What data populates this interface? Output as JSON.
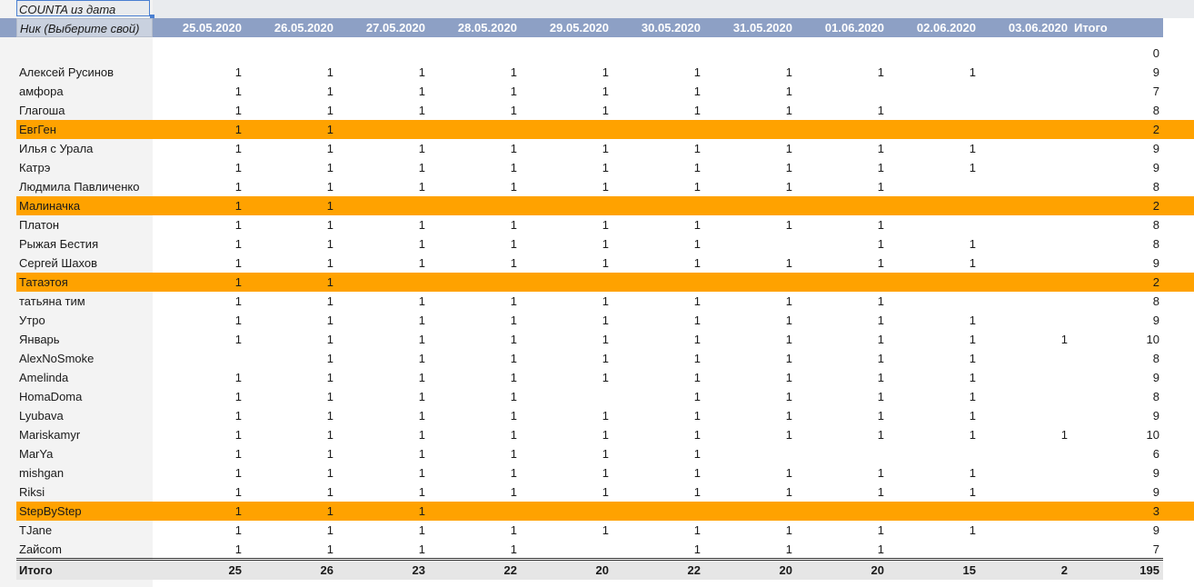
{
  "pivot": {
    "title": "COUNTA из дата",
    "row_header": "Ник (Выберите свой)",
    "dates": [
      "25.05.2020",
      "26.05.2020",
      "27.05.2020",
      "28.05.2020",
      "29.05.2020",
      "30.05.2020",
      "31.05.2020",
      "01.06.2020",
      "02.06.2020",
      "03.06.2020"
    ],
    "total_label": "Итого",
    "highlight_color": "#ffa200",
    "header_color": "#8da0c5",
    "rows": [
      {
        "name": "",
        "vals": [
          "",
          "",
          "",
          "",
          "",
          "",
          "",
          "",
          "",
          ""
        ],
        "total": "0",
        "highlight": false
      },
      {
        "name": "Алексей Русинов",
        "vals": [
          "1",
          "1",
          "1",
          "1",
          "1",
          "1",
          "1",
          "1",
          "1",
          ""
        ],
        "total": "9",
        "highlight": false
      },
      {
        "name": "амфора",
        "vals": [
          "1",
          "1",
          "1",
          "1",
          "1",
          "1",
          "1",
          "",
          "",
          ""
        ],
        "total": "7",
        "highlight": false
      },
      {
        "name": "Глагоша",
        "vals": [
          "1",
          "1",
          "1",
          "1",
          "1",
          "1",
          "1",
          "1",
          "",
          ""
        ],
        "total": "8",
        "highlight": false
      },
      {
        "name": "ЕвгГен",
        "vals": [
          "1",
          "1",
          "",
          "",
          "",
          "",
          "",
          "",
          "",
          ""
        ],
        "total": "2",
        "highlight": true
      },
      {
        "name": "Илья с Урала",
        "vals": [
          "1",
          "1",
          "1",
          "1",
          "1",
          "1",
          "1",
          "1",
          "1",
          ""
        ],
        "total": "9",
        "highlight": false
      },
      {
        "name": "Катрэ",
        "vals": [
          "1",
          "1",
          "1",
          "1",
          "1",
          "1",
          "1",
          "1",
          "1",
          ""
        ],
        "total": "9",
        "highlight": false
      },
      {
        "name": "Людмила Павличенко",
        "vals": [
          "1",
          "1",
          "1",
          "1",
          "1",
          "1",
          "1",
          "1",
          "",
          ""
        ],
        "total": "8",
        "highlight": false
      },
      {
        "name": "Малиначка",
        "vals": [
          "1",
          "1",
          "",
          "",
          "",
          "",
          "",
          "",
          "",
          ""
        ],
        "total": "2",
        "highlight": true
      },
      {
        "name": "Платон",
        "vals": [
          "1",
          "1",
          "1",
          "1",
          "1",
          "1",
          "1",
          "1",
          "",
          ""
        ],
        "total": "8",
        "highlight": false
      },
      {
        "name": "Рыжая Бестия",
        "vals": [
          "1",
          "1",
          "1",
          "1",
          "1",
          "1",
          "",
          "1",
          "1",
          ""
        ],
        "total": "8",
        "highlight": false
      },
      {
        "name": "Сергей Шахов",
        "vals": [
          "1",
          "1",
          "1",
          "1",
          "1",
          "1",
          "1",
          "1",
          "1",
          ""
        ],
        "total": "9",
        "highlight": false
      },
      {
        "name": "Татаэтоя",
        "vals": [
          "1",
          "1",
          "",
          "",
          "",
          "",
          "",
          "",
          "",
          ""
        ],
        "total": "2",
        "highlight": true
      },
      {
        "name": "татьяна тим",
        "vals": [
          "1",
          "1",
          "1",
          "1",
          "1",
          "1",
          "1",
          "1",
          "",
          ""
        ],
        "total": "8",
        "highlight": false
      },
      {
        "name": "Утро",
        "vals": [
          "1",
          "1",
          "1",
          "1",
          "1",
          "1",
          "1",
          "1",
          "1",
          ""
        ],
        "total": "9",
        "highlight": false
      },
      {
        "name": "Январь",
        "vals": [
          "1",
          "1",
          "1",
          "1",
          "1",
          "1",
          "1",
          "1",
          "1",
          "1"
        ],
        "total": "10",
        "highlight": false
      },
      {
        "name": "AlexNoSmoke",
        "vals": [
          "",
          "1",
          "1",
          "1",
          "1",
          "1",
          "1",
          "1",
          "1",
          ""
        ],
        "total": "8",
        "highlight": false
      },
      {
        "name": "Amelinda",
        "vals": [
          "1",
          "1",
          "1",
          "1",
          "1",
          "1",
          "1",
          "1",
          "1",
          ""
        ],
        "total": "9",
        "highlight": false
      },
      {
        "name": "HomaDoma",
        "vals": [
          "1",
          "1",
          "1",
          "1",
          "",
          "1",
          "1",
          "1",
          "1",
          ""
        ],
        "total": "8",
        "highlight": false
      },
      {
        "name": "Lyubava",
        "vals": [
          "1",
          "1",
          "1",
          "1",
          "1",
          "1",
          "1",
          "1",
          "1",
          ""
        ],
        "total": "9",
        "highlight": false
      },
      {
        "name": "Mariskamyr",
        "vals": [
          "1",
          "1",
          "1",
          "1",
          "1",
          "1",
          "1",
          "1",
          "1",
          "1"
        ],
        "total": "10",
        "highlight": false
      },
      {
        "name": "MarYa",
        "vals": [
          "1",
          "1",
          "1",
          "1",
          "1",
          "1",
          "",
          "",
          "",
          ""
        ],
        "total": "6",
        "highlight": false
      },
      {
        "name": "mishgan",
        "vals": [
          "1",
          "1",
          "1",
          "1",
          "1",
          "1",
          "1",
          "1",
          "1",
          ""
        ],
        "total": "9",
        "highlight": false
      },
      {
        "name": "Riksi",
        "vals": [
          "1",
          "1",
          "1",
          "1",
          "1",
          "1",
          "1",
          "1",
          "1",
          ""
        ],
        "total": "9",
        "highlight": false
      },
      {
        "name": "StepByStep",
        "vals": [
          "1",
          "1",
          "1",
          "",
          "",
          "",
          "",
          "",
          "",
          ""
        ],
        "total": "3",
        "highlight": true
      },
      {
        "name": "TJane",
        "vals": [
          "1",
          "1",
          "1",
          "1",
          "1",
          "1",
          "1",
          "1",
          "1",
          ""
        ],
        "total": "9",
        "highlight": false
      },
      {
        "name": "Zайсom",
        "vals": [
          "1",
          "1",
          "1",
          "1",
          "",
          "1",
          "1",
          "1",
          "",
          ""
        ],
        "total": "7",
        "highlight": false
      }
    ],
    "totals": {
      "label": "Итого",
      "vals": [
        "25",
        "26",
        "23",
        "22",
        "20",
        "22",
        "20",
        "20",
        "15",
        "2"
      ],
      "grand": "195"
    }
  }
}
